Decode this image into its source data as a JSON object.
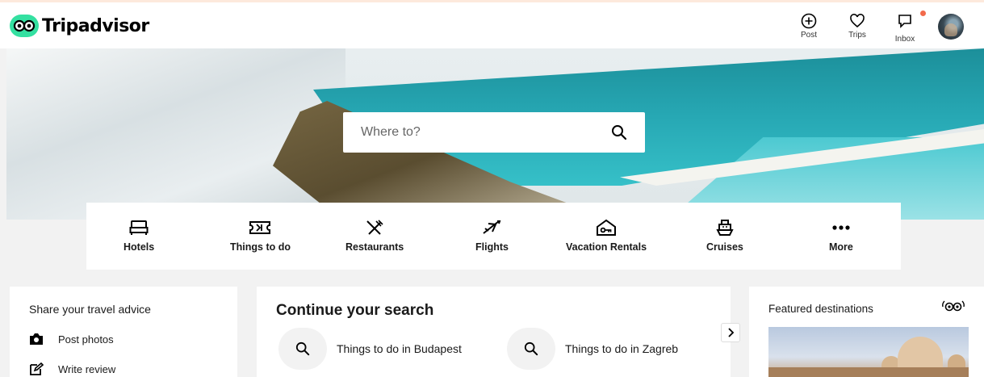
{
  "brand": {
    "name": "Tripadvisor",
    "accent": "#34e0a1"
  },
  "header_nav": [
    {
      "label": "Post",
      "icon": "plus-circle-icon"
    },
    {
      "label": "Trips",
      "icon": "heart-icon"
    },
    {
      "label": "Inbox",
      "icon": "chat-icon"
    }
  ],
  "search": {
    "placeholder": "Where to?"
  },
  "categories": [
    {
      "label": "Hotels",
      "icon": "bed-icon"
    },
    {
      "label": "Things to do",
      "icon": "ticket-icon"
    },
    {
      "label": "Restaurants",
      "icon": "utensils-icon"
    },
    {
      "label": "Flights",
      "icon": "plane-icon"
    },
    {
      "label": "Vacation Rentals",
      "icon": "house-key-icon"
    },
    {
      "label": "Cruises",
      "icon": "ship-icon"
    },
    {
      "label": "More",
      "icon": "more-dots-icon"
    }
  ],
  "advice_panel": {
    "title": "Share your travel advice",
    "items": [
      {
        "label": "Post photos",
        "icon": "camera-icon"
      },
      {
        "label": "Write review",
        "icon": "edit-icon"
      }
    ]
  },
  "continue_panel": {
    "title": "Continue your search",
    "items": [
      {
        "label": "Things to do in Budapest"
      },
      {
        "label": "Things to do in Zagreb"
      }
    ]
  },
  "featured_panel": {
    "title": "Featured destinations"
  }
}
